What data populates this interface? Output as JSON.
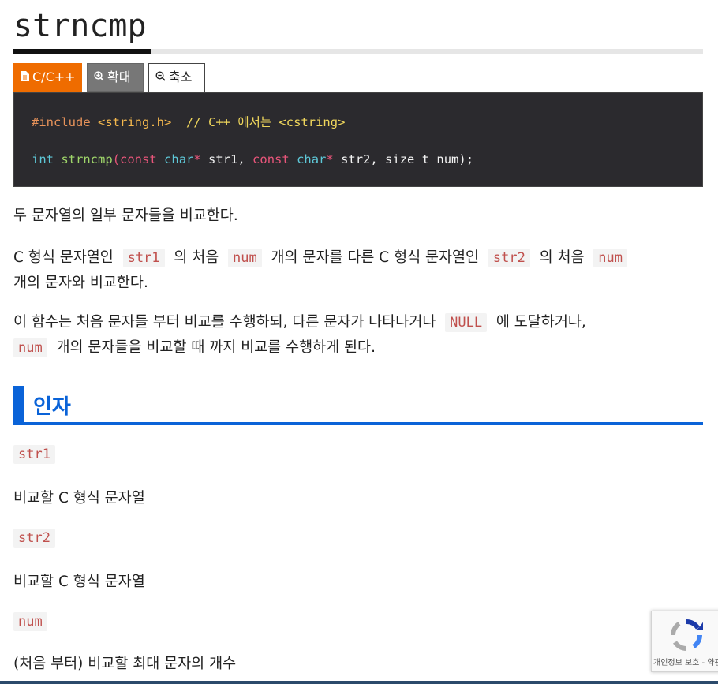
{
  "page": {
    "title": "strncmp"
  },
  "tabs": [
    {
      "icon": "document-icon",
      "label": "C/C++"
    },
    {
      "icon": "zoom-in-icon",
      "label": "확대"
    },
    {
      "icon": "zoom-out-icon",
      "label": "축소"
    }
  ],
  "code": {
    "line1": {
      "directive": "#include",
      "header": "<string.h>",
      "comment": "// C++ 에서는 <cstring>"
    },
    "line2": {
      "type": "int",
      "func": "strncmp",
      "paren_open": "(",
      "const1": "const",
      "char1": "char",
      "ptr1": "*",
      "arg1": " str1,",
      "const2": "const",
      "char2": "char",
      "ptr2": "*",
      "arg2": " str2, size_t num);"
    }
  },
  "description": {
    "p1": "두 문자열의 일부 문자들을 비교한다.",
    "p2": {
      "t1": "C 형식 문자열인",
      "c1": "str1",
      "t2": "의 처음",
      "c2": "num",
      "t3": "개의 문자를 다른 C 형식 문자열인",
      "c3": "str2",
      "t4": "의 처음",
      "c4": "num",
      "t5": "개의 문자와 비교한다."
    },
    "p3": {
      "t1": "이 함수는 처음 문자들 부터 비교를 수행하되, 다른 문자가 나타나거나",
      "c1": "NULL",
      "t2": "에 도달하거나,",
      "c2": "num",
      "t3": "개의 문자들을 비교할 때 까지 비교를 수행하게 된다."
    }
  },
  "params_section": {
    "title": "인자",
    "items": [
      {
        "name": "str1",
        "desc": "비교할 C 형식 문자열"
      },
      {
        "name": "str2",
        "desc": "비교할 C 형식 문자열"
      },
      {
        "name": "num",
        "desc": "(처음 부터) 비교할 최대 문자의 개수"
      }
    ]
  },
  "recaptcha": {
    "footer": "개인정보 보호 - 약관"
  },
  "colors": {
    "accent": "#0a63d8",
    "tab_active": "#ef6c00",
    "code_bg": "#2b2a2e",
    "inline_code": "#c0504d"
  }
}
